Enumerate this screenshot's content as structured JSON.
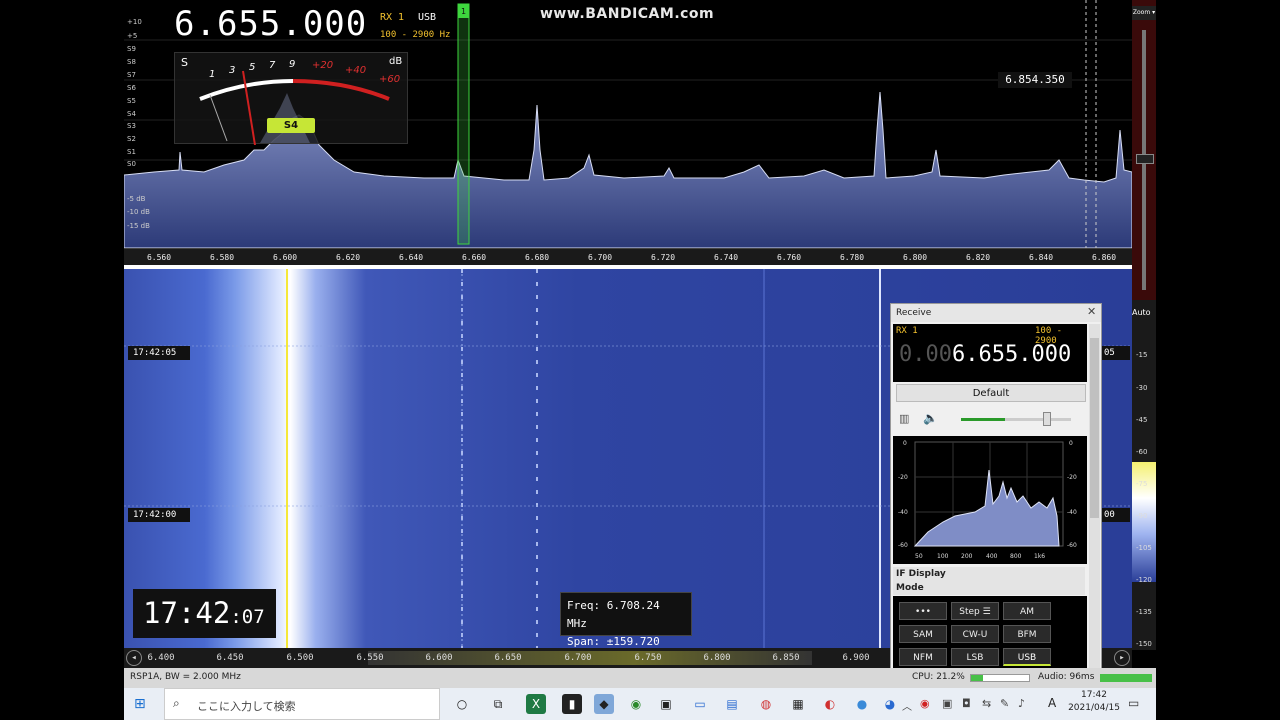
{
  "spectrum": {
    "frequency": "6.655.000",
    "rx": "RX 1",
    "mode": "USB",
    "bandwidth": "100 - 2900 Hz",
    "watermark": "www.BANDICAM.com",
    "marker_freq": "6.854.350",
    "db_scale": [
      "+10",
      "+5",
      "S9",
      "S8",
      "S7",
      "S6",
      "S5",
      "S4",
      "S3",
      "S2",
      "S1",
      "S0",
      "-5 dB",
      "-10 dB",
      "-15 dB"
    ],
    "ruler_ticks": [
      "6.560",
      "6.580",
      "6.600",
      "6.620",
      "6.640",
      "6.660",
      "6.680",
      "6.700",
      "6.720",
      "6.740",
      "6.760",
      "6.780",
      "6.800",
      "6.820",
      "6.840",
      "6.860"
    ],
    "channel_number": "1"
  },
  "smeter": {
    "s_label": "S",
    "db_label": "dB",
    "scale": [
      "1",
      "3",
      "5",
      "7",
      "9"
    ],
    "scale_db": [
      "+20",
      "+40",
      "+60"
    ],
    "reading": "S4"
  },
  "waterfall": {
    "time_1": "17:42:05",
    "time_2": "17:42:00",
    "time_1_right": "05",
    "time_2_right": "00",
    "clock_main": "17:42",
    "clock_secs": ":07",
    "tip_freq": "Freq: 6.708.24 MHz",
    "tip_span": "Span: ±159.720 kHz"
  },
  "bottom_ruler": {
    "ticks": [
      "6.400",
      "6.450",
      "6.500",
      "6.550",
      "6.600",
      "6.650",
      "6.700",
      "6.750",
      "6.800",
      "6.850",
      "6.900"
    ]
  },
  "receive": {
    "title": "Receive",
    "rx": "RX 1",
    "bw": "100 - 2900",
    "freq_dim": "0.00",
    "freq": "6.655.000",
    "default_label": "Default",
    "if_display": "IF Display",
    "mode_section": "Mode",
    "if_y_left": [
      "0",
      "-20",
      "-40",
      "-60"
    ],
    "if_y_right": [
      "0",
      "-20",
      "-40",
      "-60"
    ],
    "if_x": [
      "50",
      "100",
      "200",
      "400",
      "800",
      "1k6"
    ],
    "modes": [
      {
        "label": "•••",
        "active": false
      },
      {
        "label": "Step ☰",
        "active": false
      },
      {
        "label": "AM",
        "active": false
      },
      {
        "label": "SAM",
        "active": false
      },
      {
        "label": "CW-U",
        "active": false
      },
      {
        "label": "BFM",
        "active": false
      },
      {
        "label": "NFM",
        "active": false
      },
      {
        "label": "LSB",
        "active": false
      },
      {
        "label": "USB",
        "active": true
      }
    ]
  },
  "right_controls": {
    "zoom": "Zoom ▾",
    "auto": "Auto",
    "levels": [
      "-15",
      "-30",
      "-45",
      "-60",
      "-75",
      "-90",
      "-105",
      "-120",
      "-135",
      "-150"
    ]
  },
  "status": {
    "device": "RSP1A, BW = 2.000 MHz",
    "cpu": "CPU: 21.2%",
    "audio": "Audio: 96ms"
  },
  "taskbar": {
    "search_placeholder": "ここに入力して検索",
    "time": "17:42",
    "date": "2021/04/15",
    "ime": "A"
  },
  "colors": {
    "accent_yellow": "#f2c12e",
    "smeter_badge": "#c6e636",
    "waterfall_bg": "#2a3a8a",
    "spectrum_fill": "#6a7ab8"
  }
}
